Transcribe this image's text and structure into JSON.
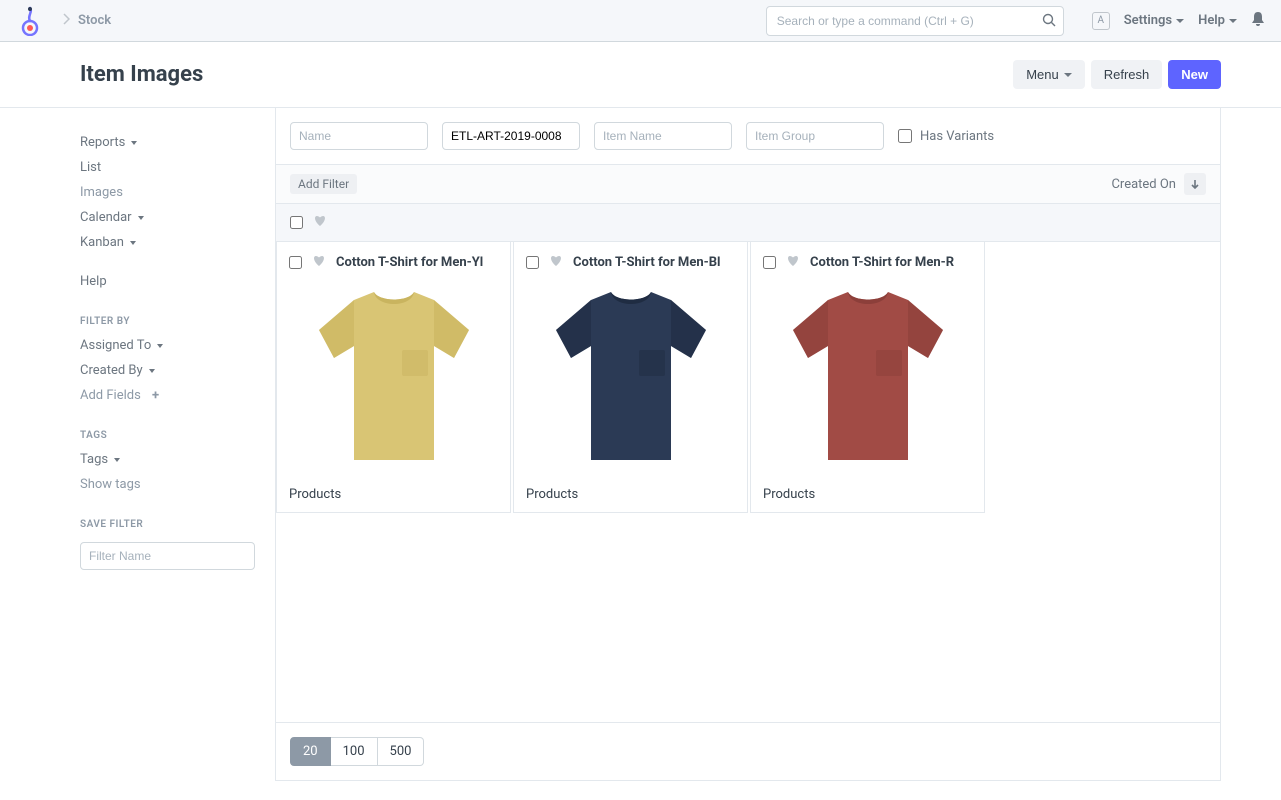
{
  "topbar": {
    "breadcrumb": "Stock",
    "search_placeholder": "Search or type a command (Ctrl + G)",
    "avatar_letter": "A",
    "settings_label": "Settings",
    "help_label": "Help"
  },
  "page": {
    "title": "Item Images",
    "menu_label": "Menu",
    "refresh_label": "Refresh",
    "new_label": "New"
  },
  "sidebar": {
    "reports": "Reports",
    "list": "List",
    "images": "Images",
    "calendar": "Calendar",
    "kanban": "Kanban",
    "help": "Help",
    "filter_by_heading": "FILTER BY",
    "assigned_to": "Assigned To",
    "created_by": "Created By",
    "add_fields": "Add Fields",
    "tags_heading": "TAGS",
    "tags": "Tags",
    "show_tags": "Show tags",
    "save_filter_heading": "SAVE FILTER",
    "filter_name_placeholder": "Filter Name"
  },
  "filters": {
    "name_placeholder": "Name",
    "item_code_value": "ETL-ART-2019-0008",
    "item_name_placeholder": "Item Name",
    "item_group_placeholder": "Item Group",
    "has_variants_label": "Has Variants",
    "add_filter_label": "Add Filter",
    "sort_by_label": "Created On"
  },
  "items": [
    {
      "title": "Cotton T-Shirt for Men-Yl",
      "category": "Products",
      "color": "#d9c574",
      "shade": "#c9b45f"
    },
    {
      "title": "Cotton T-Shirt for Men-Bl",
      "category": "Products",
      "color": "#2b3a55",
      "shade": "#1f2c42"
    },
    {
      "title": "Cotton T-Shirt for Men-R",
      "category": "Products",
      "color": "#a14b45",
      "shade": "#8c3f3a"
    }
  ],
  "pagination": {
    "options": [
      "20",
      "100",
      "500"
    ],
    "active": "20"
  }
}
